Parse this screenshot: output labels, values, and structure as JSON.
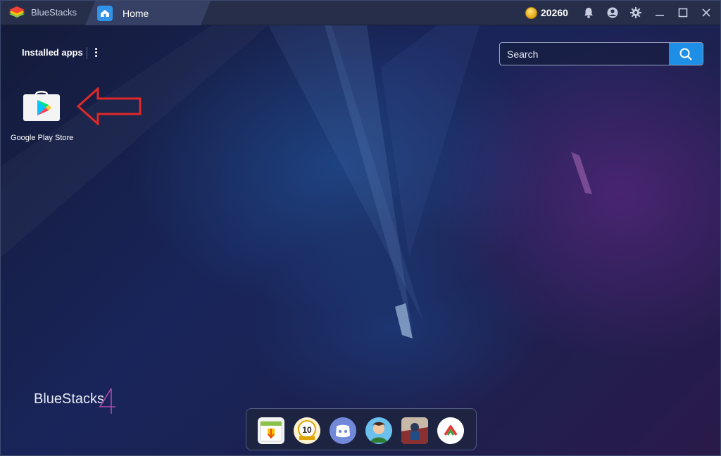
{
  "titlebar": {
    "app_name": "BlueStacks",
    "tab_label": "Home",
    "coin_count": "20260"
  },
  "home": {
    "installed_label": "Installed apps",
    "search": {
      "placeholder": "Search"
    },
    "apps": [
      {
        "name": "Google Play Store",
        "icon": "play-store-icon"
      }
    ],
    "watermark": "BlueStacks"
  },
  "dock": {
    "items": [
      {
        "icon": "app-center-icon"
      },
      {
        "icon": "anniversary-10-icon"
      },
      {
        "icon": "discord-icon"
      },
      {
        "icon": "game-character-icon"
      },
      {
        "icon": "game-art-icon"
      },
      {
        "icon": "camo-a-icon"
      }
    ]
  },
  "colors": {
    "accent": "#1d8fe6",
    "titlebar_bg": "#262e49",
    "arrow": "#e02828"
  }
}
